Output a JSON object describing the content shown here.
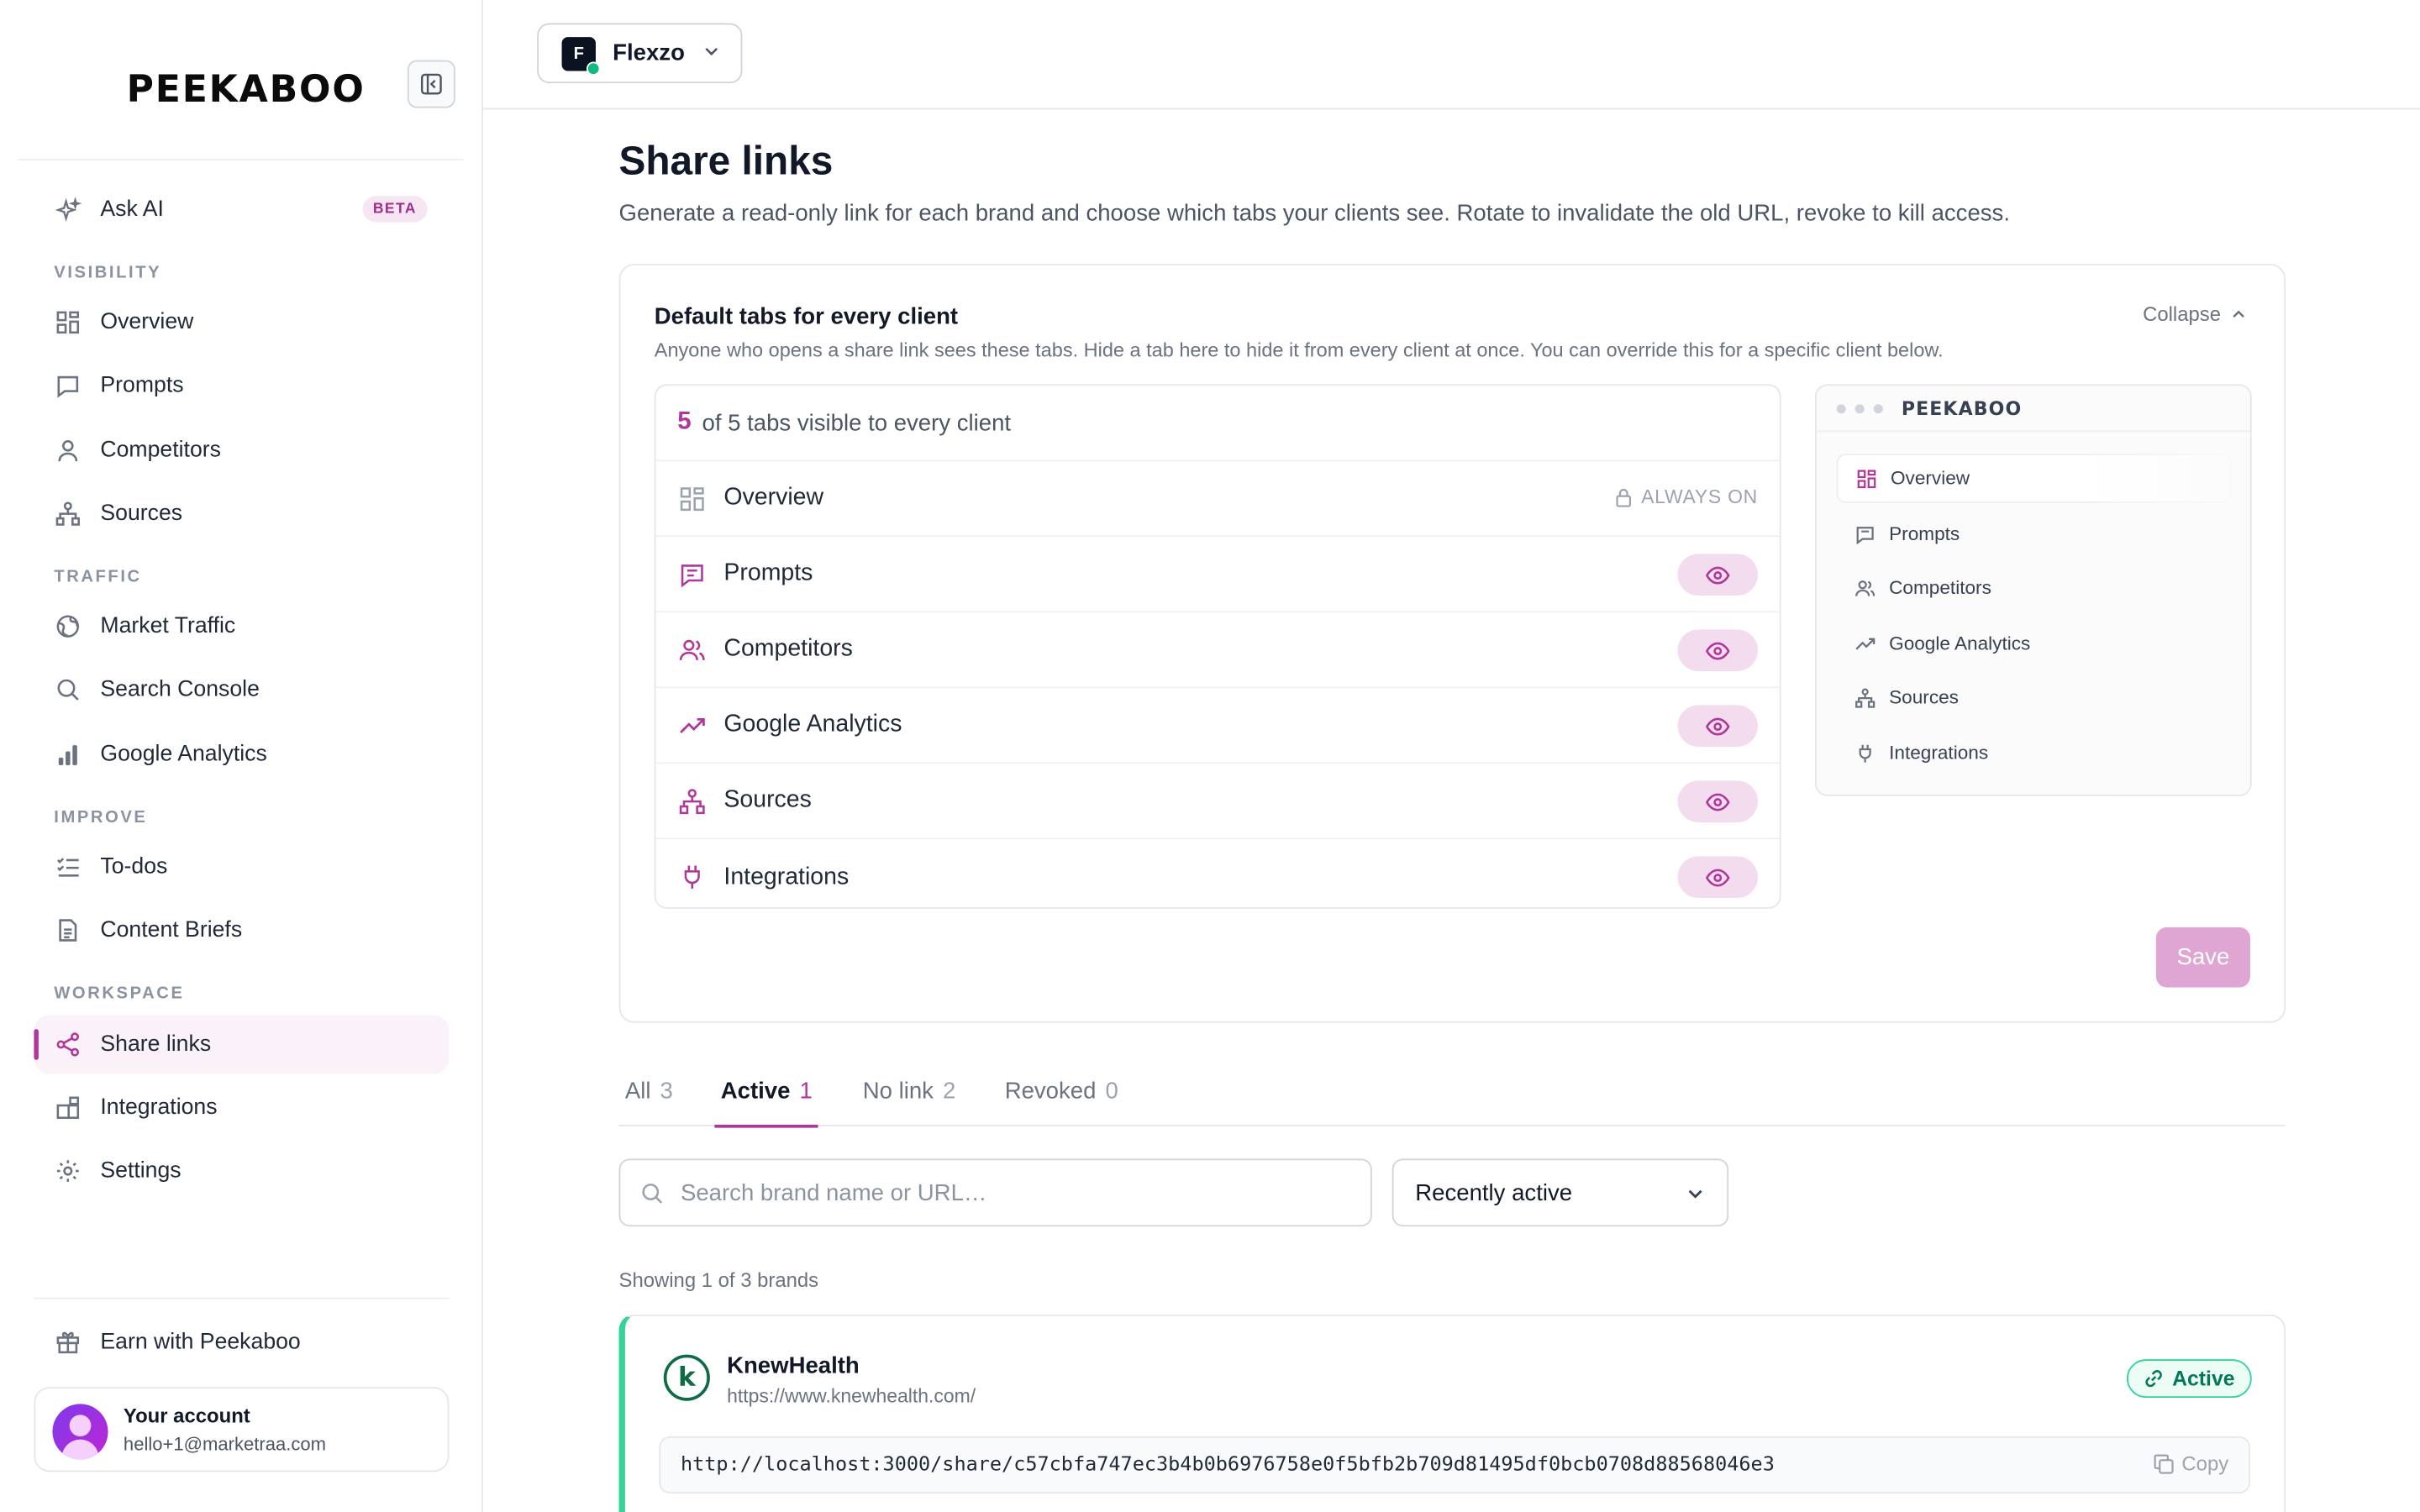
{
  "app": {
    "logo": "PEEKABOO"
  },
  "sidebar": {
    "ask_ai": {
      "label": "Ask AI",
      "badge": "BETA"
    },
    "sections": {
      "visibility": "VISIBILITY",
      "traffic": "TRAFFIC",
      "improve": "IMPROVE",
      "workspace": "WORKSPACE"
    },
    "items": {
      "overview": "Overview",
      "prompts": "Prompts",
      "competitors": "Competitors",
      "sources": "Sources",
      "market_traffic": "Market Traffic",
      "search_console": "Search Console",
      "google_analytics": "Google Analytics",
      "todos": "To-dos",
      "content_briefs": "Content Briefs",
      "share_links": "Share links",
      "integrations": "Integrations",
      "settings": "Settings"
    },
    "active_item": "share_links",
    "earn": "Earn with Peekaboo",
    "account": {
      "title": "Your account",
      "email": "hello+1@marketraa.com"
    }
  },
  "topbar": {
    "brand_initials": "F",
    "brand_name": "Flexzo"
  },
  "page": {
    "title": "Share links",
    "subtitle": "Generate a read-only link for each brand and choose which tabs your clients see. Rotate to invalidate the old URL, revoke to kill access."
  },
  "defaults_card": {
    "title": "Default tabs for every client",
    "subtitle": "Anyone who opens a share link sees these tabs. Hide a tab here to hide it from every client at once. You can override this for a specific client below.",
    "collapse_label": "Collapse",
    "visible_count": "5",
    "visible_text": "of 5 tabs visible to every client",
    "always_on_label": "ALWAYS ON",
    "tabs": [
      {
        "label": "Overview",
        "icon": "grid-icon",
        "always_on": true
      },
      {
        "label": "Prompts",
        "icon": "chat-icon",
        "visible": true
      },
      {
        "label": "Competitors",
        "icon": "users-icon",
        "visible": true
      },
      {
        "label": "Google Analytics",
        "icon": "trend-icon",
        "visible": true
      },
      {
        "label": "Sources",
        "icon": "sitemap-icon",
        "visible": true
      },
      {
        "label": "Integrations",
        "icon": "plug-icon",
        "visible": true
      }
    ],
    "preview": {
      "logo": "PEEKABOO",
      "items": [
        "Overview",
        "Prompts",
        "Competitors",
        "Google Analytics",
        "Sources",
        "Integrations"
      ],
      "selected": "Overview"
    },
    "save_label": "Save"
  },
  "filters": {
    "tabs": [
      {
        "label": "All",
        "count": "3"
      },
      {
        "label": "Active",
        "count": "1",
        "active": true
      },
      {
        "label": "No link",
        "count": "2"
      },
      {
        "label": "Revoked",
        "count": "0"
      }
    ],
    "search_placeholder": "Search brand name or URL…",
    "sort_value": "Recently active",
    "showing": "Showing 1 of 3 brands"
  },
  "brands": [
    {
      "initial": "k",
      "name": "KnewHealth",
      "url": "https://www.knewhealth.com/",
      "status": "Active",
      "share_url": "http://localhost:3000/share/c57cbfa747ec3b4b0b6976758e0f5bfb2b709d81495df0bcb0708d88568046e3",
      "copy_label": "Copy"
    }
  ],
  "colors": {
    "accent": "#b0369a",
    "accent_soft": "#f3dcee",
    "active_green": "#34d399"
  }
}
